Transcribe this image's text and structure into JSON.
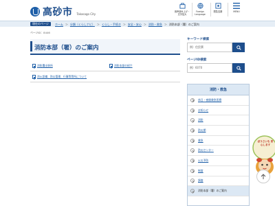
{
  "header": {
    "logo_text": "高砂市",
    "logo_sub": "Takasago City",
    "buttons": [
      {
        "label": "音声読み上げ・文字拡大",
        "icon": "speaker-icon"
      },
      {
        "label": "Foreign Language",
        "icon": "globe-icon"
      },
      {
        "label": "閲覧支援",
        "icon": "settings-icon"
      },
      {
        "label": "MENU",
        "icon": "hamburger-icon"
      }
    ]
  },
  "breadcrumb": {
    "label": "現在のページ",
    "items": [
      "ホーム",
      "分類（くらしナビ）",
      "くらし・手続き",
      "安全・安心",
      "消防・救急"
    ],
    "current": "消防本部（署）のご案内"
  },
  "page": {
    "page_id": "ページID：8446",
    "title": "消防本部（署）のご案内",
    "links": [
      "消防署出張所",
      "消防本部の紹介",
      "消火設備、防災管理、行事等等所について"
    ]
  },
  "sidebar": {
    "keyword_title": "キーワード検索",
    "keyword_placeholder": "例）住民票",
    "pageid_title": "ページID検索",
    "pageid_placeholder": "例）6070",
    "menu_title": "消防・救急",
    "menu_items": [
      "休日・夜間救急医療",
      "お知らせ",
      "消防",
      "防災期",
      "救急",
      "防災センター",
      "火災予防",
      "制度",
      "調査",
      "消防本部（署）のご案内"
    ],
    "active_index": 9
  },
  "mascot": {
    "speech": "ぼうさいも 安心します"
  },
  "colors": {
    "primary": "#1e4e8c",
    "link": "#1e5fa8",
    "menu_bg": "#dce8f4"
  }
}
